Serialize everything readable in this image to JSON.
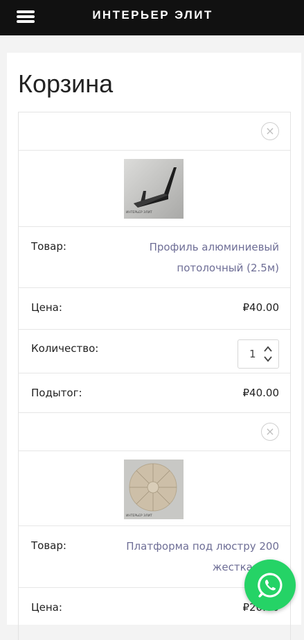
{
  "header": {
    "brand": "ИНТЕРЬЕР ЭЛИТ"
  },
  "page": {
    "title": "Корзина"
  },
  "labels": {
    "product": "Товар:",
    "price": "Цена:",
    "quantity": "Количество:",
    "subtotal": "Подытог:"
  },
  "cart_items": [
    {
      "name_line1": "Профиль алюминиевый",
      "name_line2": "потолочный (2.5м)",
      "price": "₽40.00",
      "quantity": "1",
      "subtotal": "₽40.00",
      "thumb_caption": "ИНТЕРЬЕР ЭЛИТ"
    },
    {
      "name_line1": "Платформа под люстру 200",
      "name_line2": "жесткая (бе",
      "price": "₽20.00",
      "thumb_caption": "ИНТЕРЬЕР ЭЛИТ"
    }
  ],
  "icons": {
    "menu": "hamburger-icon",
    "remove": "close-circle-icon",
    "whatsapp": "whatsapp-icon",
    "remove_glyph": "×"
  },
  "colors": {
    "header_bg": "#111111",
    "link": "#6e6e96",
    "whatsapp": "#25d366"
  }
}
